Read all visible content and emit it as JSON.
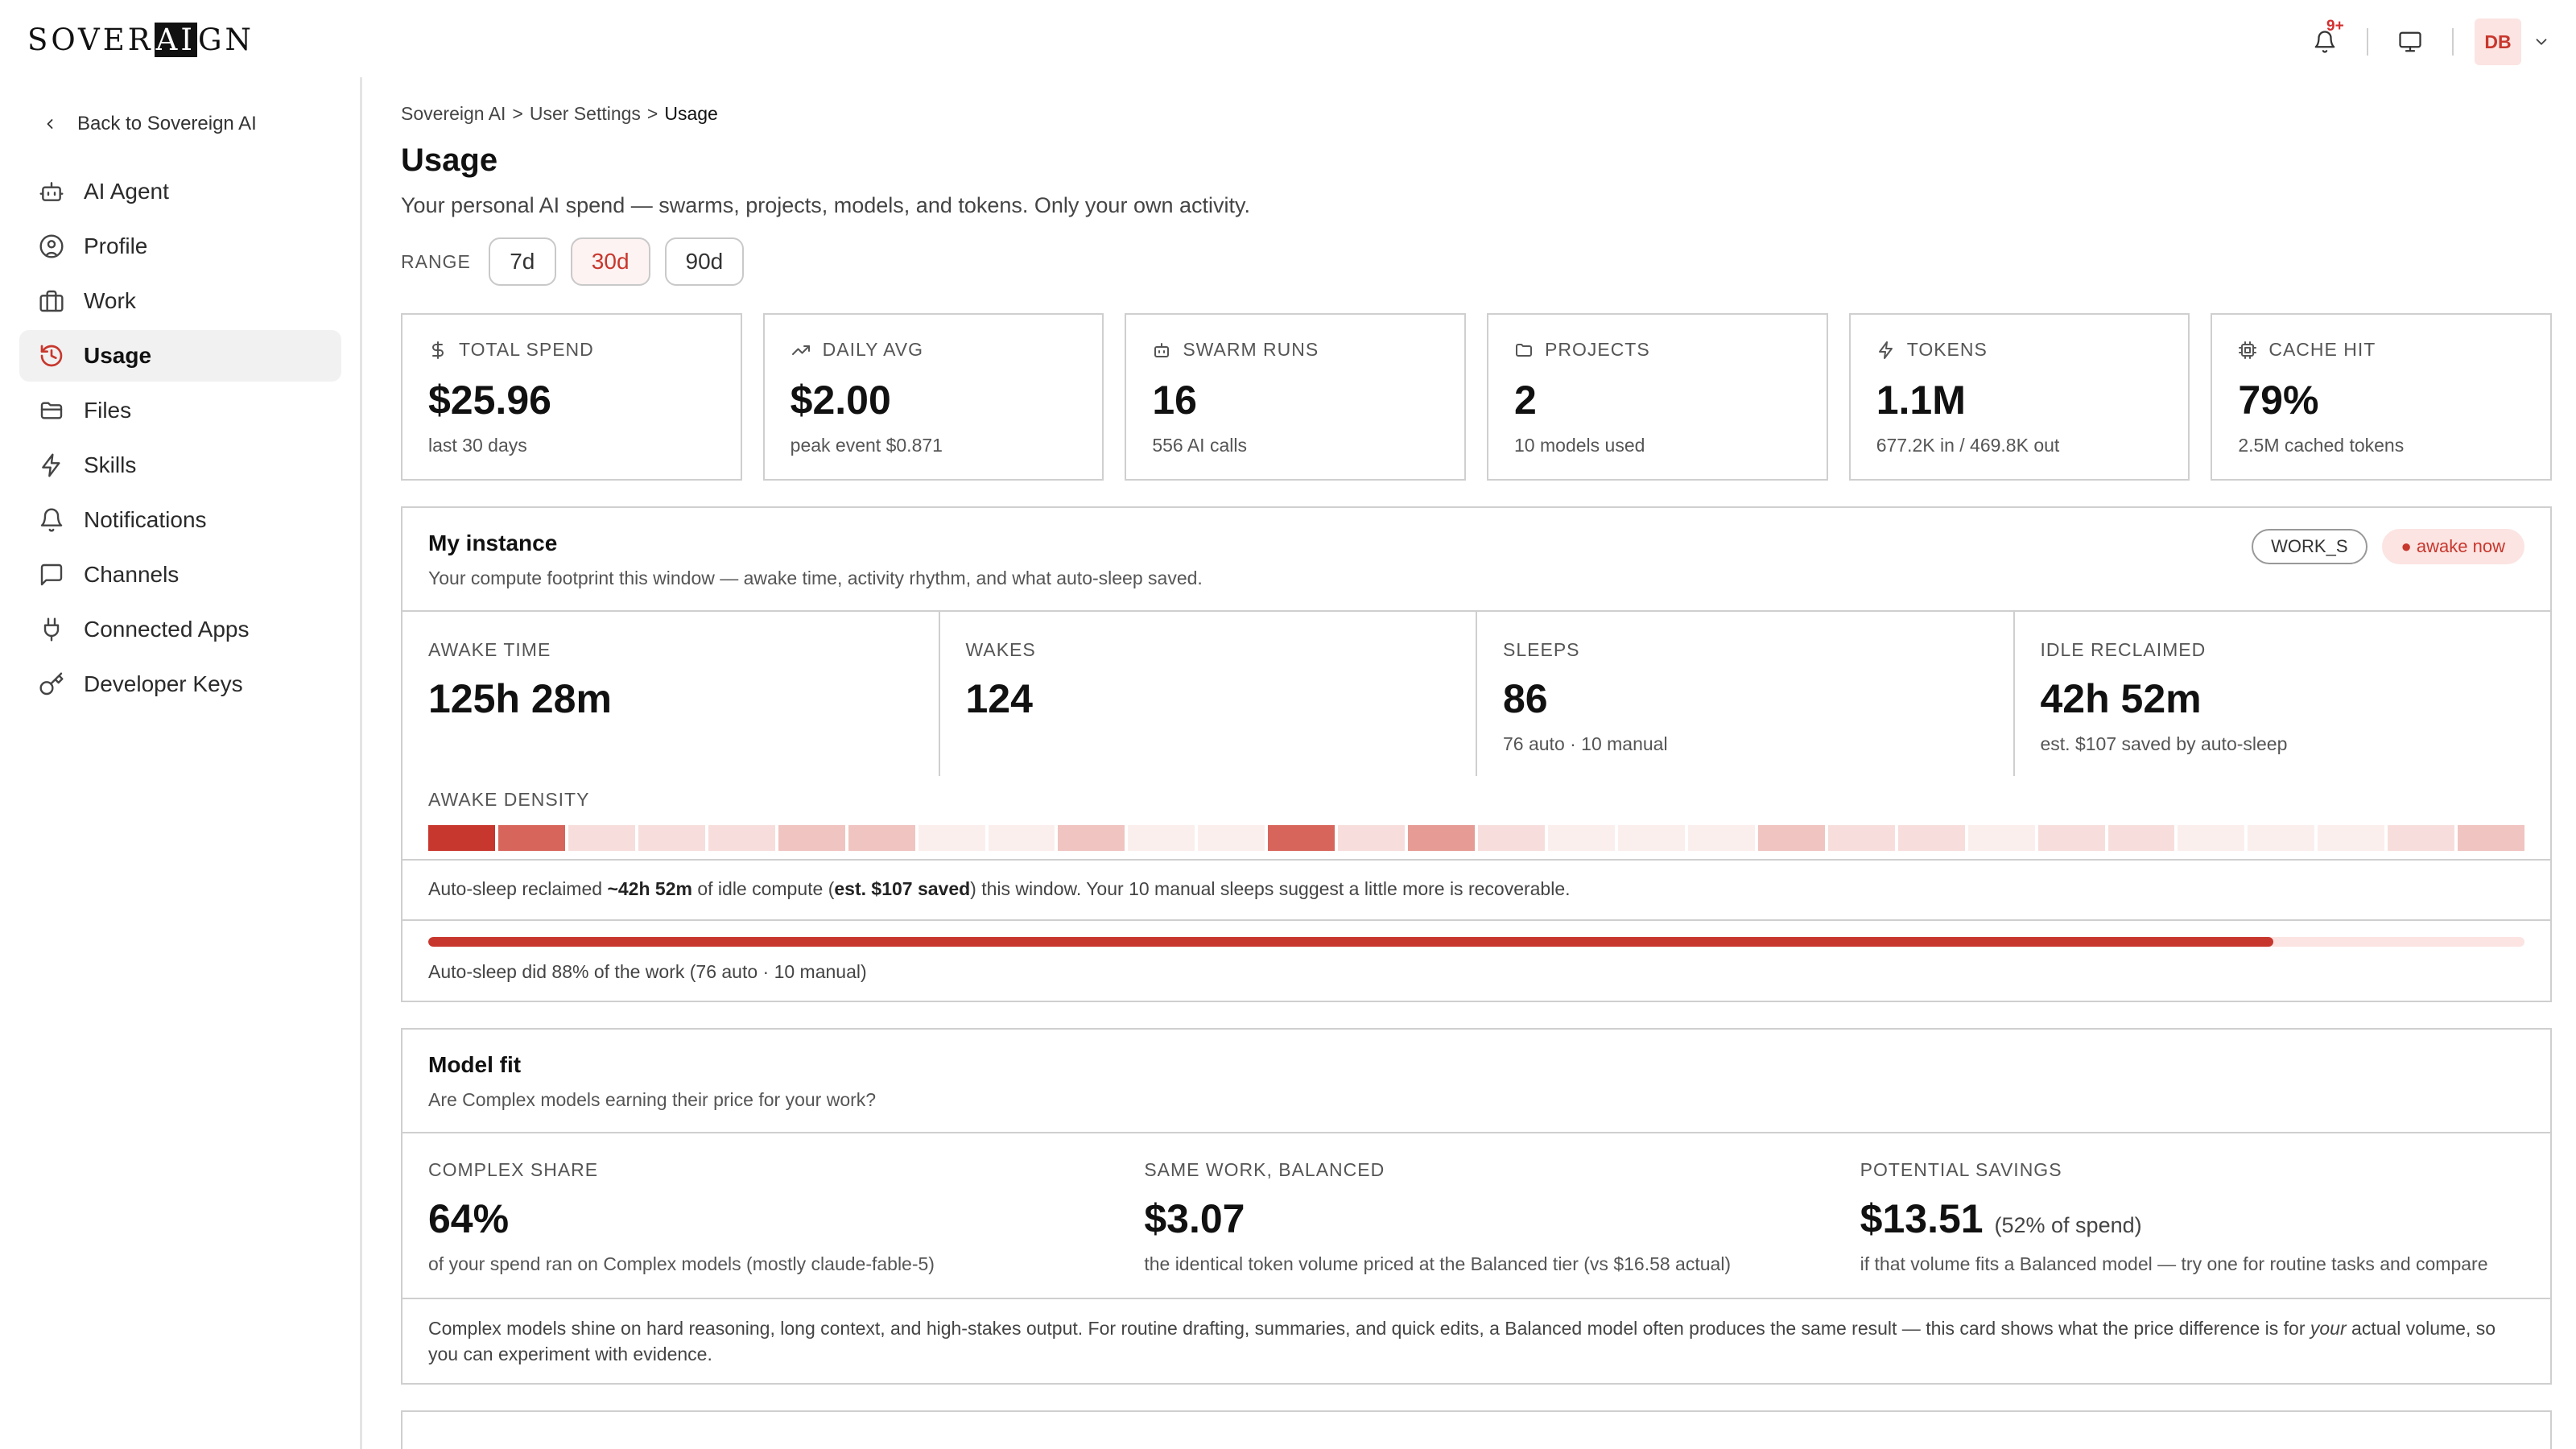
{
  "header": {
    "logo": {
      "pre": "SOVER",
      "inv": "AI",
      "post": "GN"
    },
    "notif_badge": "9+",
    "avatar_initials": "DB"
  },
  "sidebar": {
    "back_label": "Back to Sovereign AI",
    "items": [
      {
        "label": "AI Agent",
        "icon": "robot-icon"
      },
      {
        "label": "Profile",
        "icon": "user-circle-icon"
      },
      {
        "label": "Work",
        "icon": "briefcase-icon"
      },
      {
        "label": "Usage",
        "icon": "history-icon",
        "active": true
      },
      {
        "label": "Files",
        "icon": "folder-icon"
      },
      {
        "label": "Skills",
        "icon": "bolt-icon"
      },
      {
        "label": "Notifications",
        "icon": "bell-icon"
      },
      {
        "label": "Channels",
        "icon": "chat-icon"
      },
      {
        "label": "Connected Apps",
        "icon": "plug-icon"
      },
      {
        "label": "Developer Keys",
        "icon": "key-icon"
      }
    ]
  },
  "breadcrumb": {
    "root": "Sovereign AI",
    "sep": ">",
    "mid": "User Settings",
    "current": "Usage"
  },
  "page": {
    "title": "Usage",
    "subtitle": "Your personal AI spend — swarms, projects, models, and tokens. Only your own activity."
  },
  "range": {
    "label": "RANGE",
    "options": [
      "7d",
      "30d",
      "90d"
    ],
    "selected": "30d"
  },
  "stats": [
    {
      "label": "TOTAL SPEND",
      "value": "$25.96",
      "note": "last 30 days",
      "icon": "dollar-icon"
    },
    {
      "label": "DAILY AVG",
      "value": "$2.00",
      "note": "peak event $0.871",
      "icon": "trend-up-icon"
    },
    {
      "label": "SWARM RUNS",
      "value": "16",
      "note": "556 AI calls",
      "icon": "robot-icon"
    },
    {
      "label": "PROJECTS",
      "value": "2",
      "note": "10 models used",
      "icon": "folder-icon"
    },
    {
      "label": "TOKENS",
      "value": "1.1M",
      "note": "677.2K in / 469.8K out",
      "icon": "bolt-icon"
    },
    {
      "label": "CACHE HIT",
      "value": "79%",
      "note": "2.5M cached tokens",
      "icon": "chip-icon"
    }
  ],
  "instance": {
    "title": "My instance",
    "subtitle": "Your compute footprint this window — awake time, activity rhythm, and what auto-sleep saved.",
    "size_tag": "WORK_S",
    "status_tag": "● awake now",
    "metrics": [
      {
        "label": "AWAKE TIME",
        "value": "125h 28m",
        "note": ""
      },
      {
        "label": "WAKES",
        "value": "124",
        "note": ""
      },
      {
        "label": "SLEEPS",
        "value": "86",
        "note": "76 auto · 10 manual"
      },
      {
        "label": "IDLE RECLAIMED",
        "value": "42h 52m",
        "note": "est. $107 saved by auto-sleep"
      }
    ],
    "density_label": "AWAKE DENSITY",
    "density": [
      5,
      4,
      1,
      1,
      1,
      2,
      2,
      0,
      0,
      2,
      0,
      0,
      4,
      1,
      3,
      1,
      0,
      0,
      0,
      2,
      1,
      1,
      0,
      1,
      1,
      0,
      0,
      0,
      1,
      2
    ],
    "density_colors": [
      "#fbefee",
      "#f7dedc",
      "#f0c4c0",
      "#e79b95",
      "#d8655c",
      "#c8372d"
    ],
    "reclaim_note": {
      "a": "Auto-sleep reclaimed ",
      "b": "~42h 52m",
      "c": " of idle compute (",
      "d": "est. $107 saved",
      "e": ") this window. Your 10 manual sleeps suggest a little more is recoverable."
    },
    "auto_share": 0.88,
    "progress_label": "Auto-sleep did 88% of the work (76 auto · 10 manual)"
  },
  "model_fit": {
    "title": "Model fit",
    "subtitle": "Are Complex models earning their price for your work?",
    "metrics": [
      {
        "label": "COMPLEX SHARE",
        "value": "64%",
        "small": "",
        "note": "of your spend ran on Complex models (mostly claude-fable-5)"
      },
      {
        "label": "SAME WORK, BALANCED",
        "value": "$3.07",
        "small": "",
        "note": "the identical token volume priced at the Balanced tier (vs $16.58 actual)"
      },
      {
        "label": "POTENTIAL SAVINGS",
        "value": "$13.51",
        "small": "(52% of spend)",
        "note": "if that volume fits a Balanced model — try one for routine tasks and compare"
      }
    ],
    "footnote_a": "Complex models shine on hard reasoning, long context, and high-stakes output. For routine drafting, summaries, and quick edits, a Balanced model often produces the same result — this card shows what the price difference is for ",
    "footnote_em": "your",
    "footnote_b": " actual volume, so you can experiment with evidence."
  }
}
